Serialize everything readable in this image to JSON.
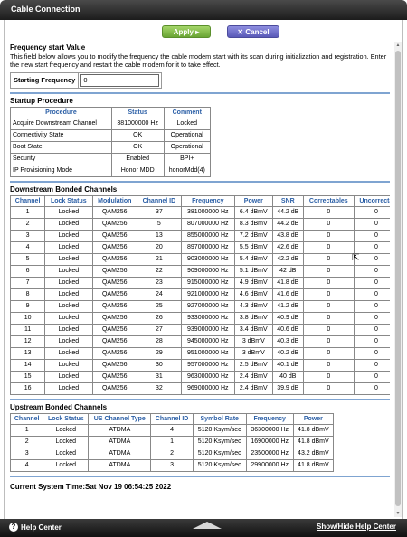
{
  "window": {
    "title": "Cable Connection"
  },
  "toolbar": {
    "apply_label": "Apply",
    "cancel_label": "Cancel",
    "apply_icon": "▸",
    "cancel_icon": "✕"
  },
  "frequency": {
    "title": "Frequency start Value",
    "description": "This field below allows you to modify the frequency the cable modem start with its scan during initialization and registration. Enter the new start frequency and restart the cable modem for it to take effect.",
    "label": "Starting Frequency",
    "value": "0"
  },
  "startup": {
    "title": "Startup Procedure",
    "headers": [
      "Procedure",
      "Status",
      "Comment"
    ],
    "rows": [
      [
        "Acquire Downstream Channel",
        "381000000 Hz",
        "Locked"
      ],
      [
        "Connectivity State",
        "OK",
        "Operational"
      ],
      [
        "Boot State",
        "OK",
        "Operational"
      ],
      [
        "Security",
        "Enabled",
        "BPI+"
      ],
      [
        "IP Provisioning Mode",
        "Honor MDD",
        "honorMdd(4)"
      ]
    ]
  },
  "downstream": {
    "title": "Downstream Bonded Channels",
    "headers": [
      "Channel",
      "Lock Status",
      "Modulation",
      "Channel ID",
      "Frequency",
      "Power",
      "SNR",
      "Correctables",
      "Uncorrecta"
    ],
    "rows": [
      [
        "1",
        "Locked",
        "QAM256",
        "37",
        "381000000 Hz",
        "6.4 dBmV",
        "44.2 dB",
        "0",
        "0"
      ],
      [
        "2",
        "Locked",
        "QAM256",
        "5",
        "807000000 Hz",
        "8.3 dBmV",
        "44.2 dB",
        "0",
        "0"
      ],
      [
        "3",
        "Locked",
        "QAM256",
        "13",
        "855000000 Hz",
        "7.2 dBmV",
        "43.8 dB",
        "0",
        "0"
      ],
      [
        "4",
        "Locked",
        "QAM256",
        "20",
        "897000000 Hz",
        "5.5 dBmV",
        "42.6 dB",
        "0",
        "0"
      ],
      [
        "5",
        "Locked",
        "QAM256",
        "21",
        "903000000 Hz",
        "5.4 dBmV",
        "42.2 dB",
        "0",
        "0"
      ],
      [
        "6",
        "Locked",
        "QAM256",
        "22",
        "909000000 Hz",
        "5.1 dBmV",
        "42 dB",
        "0",
        "0"
      ],
      [
        "7",
        "Locked",
        "QAM256",
        "23",
        "915000000 Hz",
        "4.9 dBmV",
        "41.8 dB",
        "0",
        "0"
      ],
      [
        "8",
        "Locked",
        "QAM256",
        "24",
        "921000000 Hz",
        "4.6 dBmV",
        "41.6 dB",
        "0",
        "0"
      ],
      [
        "9",
        "Locked",
        "QAM256",
        "25",
        "927000000 Hz",
        "4.3 dBmV",
        "41.2 dB",
        "0",
        "0"
      ],
      [
        "10",
        "Locked",
        "QAM256",
        "26",
        "933000000 Hz",
        "3.8 dBmV",
        "40.9 dB",
        "0",
        "0"
      ],
      [
        "11",
        "Locked",
        "QAM256",
        "27",
        "939000000 Hz",
        "3.4 dBmV",
        "40.6 dB",
        "0",
        "0"
      ],
      [
        "12",
        "Locked",
        "QAM256",
        "28",
        "945000000 Hz",
        "3 dBmV",
        "40.3 dB",
        "0",
        "0"
      ],
      [
        "13",
        "Locked",
        "QAM256",
        "29",
        "951000000 Hz",
        "3 dBmV",
        "40.2 dB",
        "0",
        "0"
      ],
      [
        "14",
        "Locked",
        "QAM256",
        "30",
        "957000000 Hz",
        "2.5 dBmV",
        "40.1 dB",
        "0",
        "0"
      ],
      [
        "15",
        "Locked",
        "QAM256",
        "31",
        "963000000 Hz",
        "2.4 dBmV",
        "40 dB",
        "0",
        "0"
      ],
      [
        "16",
        "Locked",
        "QAM256",
        "32",
        "969000000 Hz",
        "2.4 dBmV",
        "39.9 dB",
        "0",
        "0"
      ]
    ]
  },
  "upstream": {
    "title": "Upstream Bonded Channels",
    "headers": [
      "Channel",
      "Lock Status",
      "US Channel Type",
      "Channel ID",
      "Symbol Rate",
      "Frequency",
      "Power"
    ],
    "rows": [
      [
        "1",
        "Locked",
        "ATDMA",
        "4",
        "5120 Ksym/sec",
        "36300000 Hz",
        "41.8 dBmV"
      ],
      [
        "2",
        "Locked",
        "ATDMA",
        "1",
        "5120 Ksym/sec",
        "16900000 Hz",
        "41.8 dBmV"
      ],
      [
        "3",
        "Locked",
        "ATDMA",
        "2",
        "5120 Ksym/sec",
        "23500000 Hz",
        "43.2 dBmV"
      ],
      [
        "4",
        "Locked",
        "ATDMA",
        "3",
        "5120 Ksym/sec",
        "29900000 Hz",
        "41.8 dBmV"
      ]
    ]
  },
  "system_time": "Current System Time:Sat Nov 19 06:54:25 2022",
  "footer": {
    "help_center": "Help Center",
    "show_hide": "Show/Hide Help Center",
    "help_icon": "?"
  },
  "colors": {
    "header_text": "#2b5fa6",
    "divider": "#7fa4d1",
    "apply": "#7ab83e",
    "cancel": "#6666c8"
  }
}
